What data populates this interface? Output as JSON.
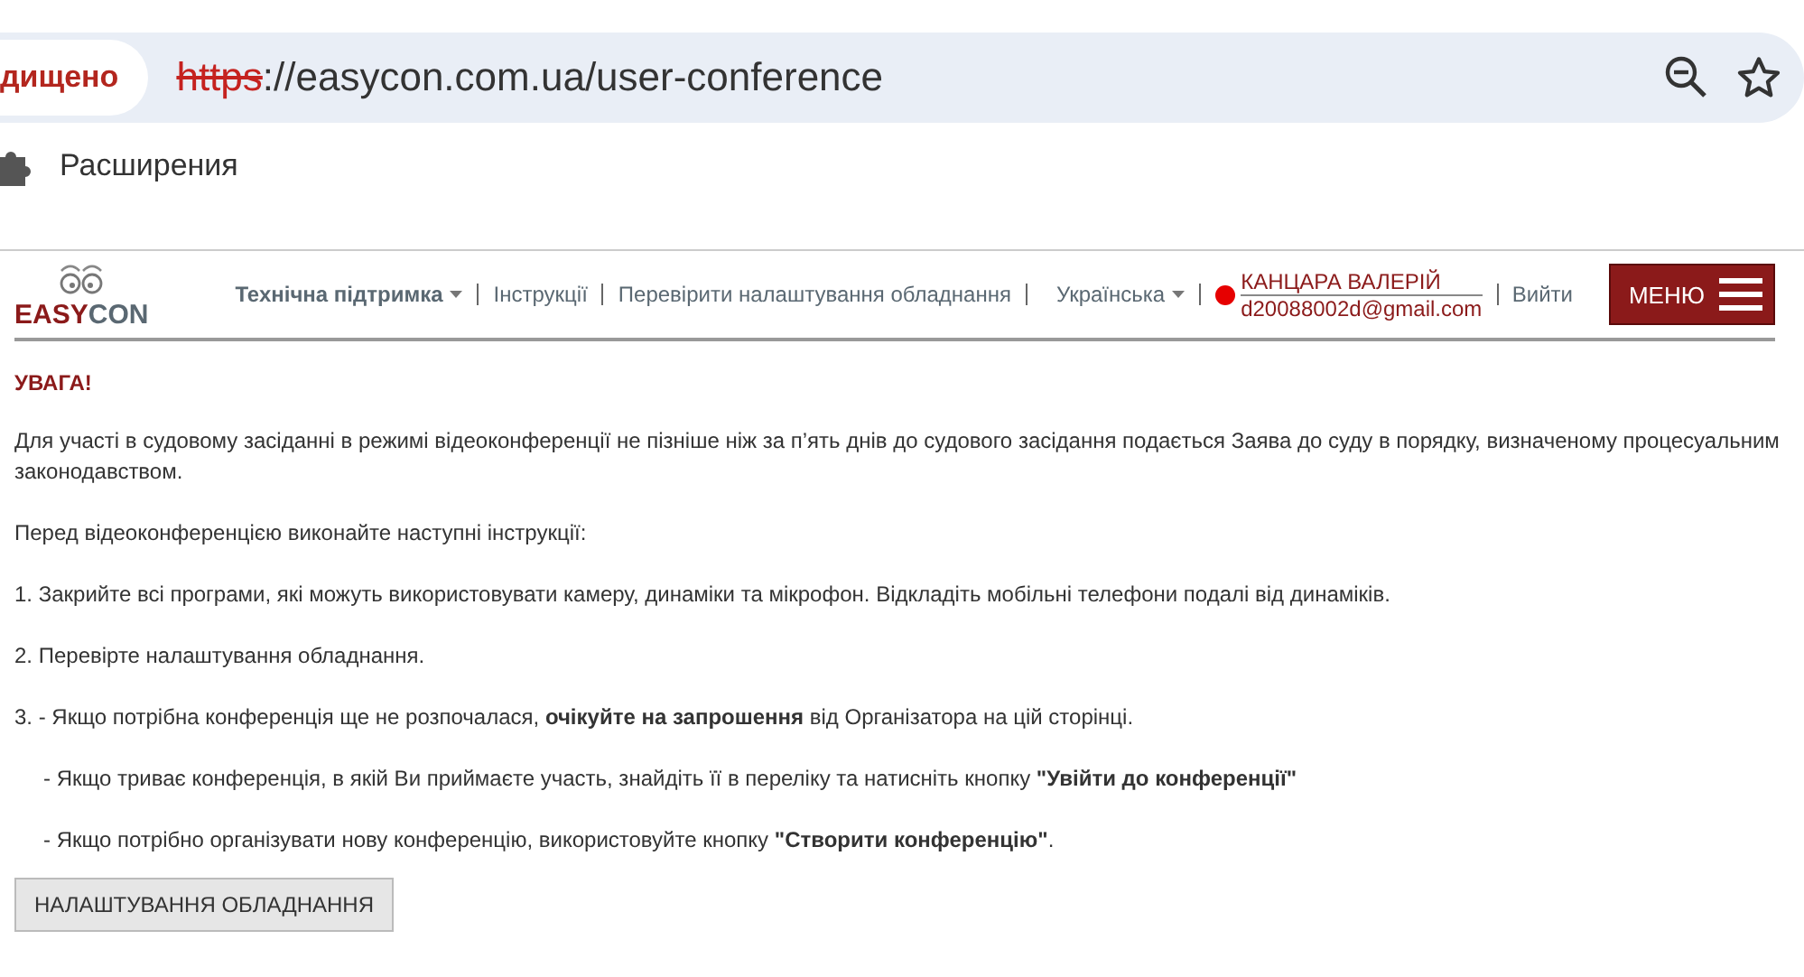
{
  "browser": {
    "security_badge": "дищено",
    "url": {
      "scheme": "https",
      "rest": "://easycon.com.ua/user-conference",
      "insecure": true
    },
    "extensions_label": "Расширения"
  },
  "header": {
    "logo": {
      "part1": "EASY",
      "part2": "CON"
    },
    "nav": [
      {
        "kind": "dropdown",
        "label": "Технічна підтримка"
      },
      {
        "kind": "link",
        "label": "Інструкції"
      },
      {
        "kind": "link",
        "label": "Перевірити налаштування обладнання"
      },
      {
        "kind": "dropdown",
        "label": "Українська"
      }
    ],
    "user": {
      "name": "КАНЦАРА ВАЛЕРІЙ",
      "email": "d20088002d@gmail.com",
      "online": true
    },
    "logout": "Вийти",
    "menu_button": "МЕНЮ"
  },
  "content": {
    "warning": "УВАГА!",
    "paragraphs": [
      {
        "indent": false,
        "text": "Для участі в судовому засіданні в режимі відеоконференції не пізніше ніж за п’ять днів до судового засідання подається Заява до суду в порядку, визначеному процесуальним законодавством."
      },
      {
        "indent": false,
        "text": "Перед відеоконференцією виконайте наступні інструкції:"
      },
      {
        "indent": false,
        "text": "1. Закрийте всі програми, які можуть використовувати камеру, динаміки та мікрофон. Відкладіть мобільні телефони подалі від динаміків."
      },
      {
        "indent": false,
        "text": "2. Перевірте налаштування обладнання."
      },
      {
        "indent": false,
        "text": "3.  - Якщо потрібна конференція ще не розпочалася, **очікуйте на запрошення** від Організатора на цій сторінці."
      },
      {
        "indent": true,
        "text": "- Якщо триває конференція, в якій Ви приймаєте участь, знайдіть її в переліку та натисніть кнопку **\"Увійти до конференції\"**"
      },
      {
        "indent": true,
        "text": "- Якщо потрібно організувати нову конференцію, використовуйте кнопку **\"Створити конференцію\"**."
      }
    ],
    "settings_button": "НАЛАШТУВАННЯ ОБЛАДНАННЯ"
  }
}
